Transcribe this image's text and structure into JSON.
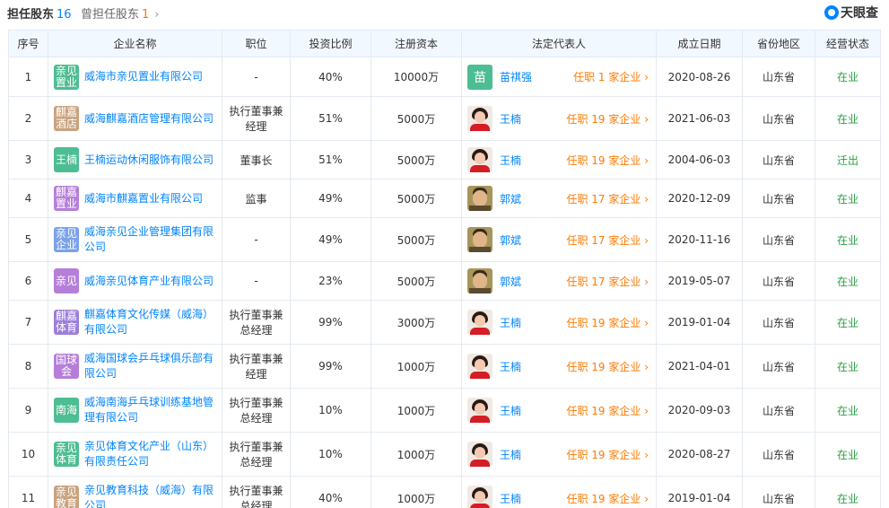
{
  "header": {
    "active_tab": "担任股东",
    "active_count": "16",
    "other_tab": "曾担任股东",
    "other_count": "1",
    "chevron": "›",
    "logo_text": "天眼查"
  },
  "columns": [
    "序号",
    "企业名称",
    "职位",
    "投资比例",
    "注册资本",
    "法定代表人",
    "成立日期",
    "省份地区",
    "经营状态"
  ],
  "rows": [
    {
      "idx": "1",
      "logo_text": "亲见置业",
      "logo_color": "#4dbd93",
      "name": "威海市亲见置业有限公司",
      "position": "-",
      "ratio": "40%",
      "capital": "10000万",
      "rep_name": "苗祺强",
      "rep_avatar": "苗",
      "rep_avatar_color": "#4dbd93",
      "rep_link": "任职 1 家企业",
      "date": "2020-08-26",
      "region": "山东省",
      "status": "在业",
      "status_color": "#27a243"
    },
    {
      "idx": "2",
      "logo_text": "麒嘉酒店",
      "logo_color": "#c9a27e",
      "name": "威海麒嘉酒店管理有限公司",
      "position": "执行董事兼经理",
      "ratio": "51%",
      "capital": "5000万",
      "rep_name": "王楠",
      "rep_avatar": "",
      "rep_avatar_color": "",
      "rep_link": "任职 19 家企业",
      "date": "2021-06-03",
      "region": "山东省",
      "status": "在业",
      "status_color": "#27a243"
    },
    {
      "idx": "3",
      "logo_text": "王楠",
      "logo_color": "#4dbd93",
      "name": "王楠运动休闲服饰有限公司",
      "position": "董事长",
      "ratio": "51%",
      "capital": "5000万",
      "rep_name": "王楠",
      "rep_avatar": "",
      "rep_avatar_color": "",
      "rep_link": "任职 19 家企业",
      "date": "2004-06-03",
      "region": "山东省",
      "status": "迁出",
      "status_color": "#27a243"
    },
    {
      "idx": "4",
      "logo_text": "麒嘉置业",
      "logo_color": "#b67ed8",
      "name": "威海市麒嘉置业有限公司",
      "position": "监事",
      "ratio": "49%",
      "capital": "5000万",
      "rep_name": "郭斌",
      "rep_avatar": "",
      "rep_avatar_color": "",
      "rep_link": "任职 17 家企业",
      "date": "2020-12-09",
      "region": "山东省",
      "status": "在业",
      "status_color": "#27a243"
    },
    {
      "idx": "5",
      "logo_text": "亲见企业",
      "logo_color": "#7aa2e8",
      "name": "威海亲见企业管理集团有限公司",
      "position": "-",
      "ratio": "49%",
      "capital": "5000万",
      "rep_name": "郭斌",
      "rep_avatar": "",
      "rep_avatar_color": "",
      "rep_link": "任职 17 家企业",
      "date": "2020-11-16",
      "region": "山东省",
      "status": "在业",
      "status_color": "#27a243"
    },
    {
      "idx": "6",
      "logo_text": "亲见",
      "logo_color": "#b67ed8",
      "name": "威海亲见体育产业有限公司",
      "position": "-",
      "ratio": "23%",
      "capital": "5000万",
      "rep_name": "郭斌",
      "rep_avatar": "",
      "rep_avatar_color": "",
      "rep_link": "任职 17 家企业",
      "date": "2019-05-07",
      "region": "山东省",
      "status": "在业",
      "status_color": "#27a243"
    },
    {
      "idx": "7",
      "logo_text": "麒嘉体育",
      "logo_color": "#9b7ed8",
      "name": "麒嘉体育文化传媒（威海）有限公司",
      "position": "执行董事兼总经理",
      "ratio": "99%",
      "capital": "3000万",
      "rep_name": "王楠",
      "rep_avatar": "",
      "rep_avatar_color": "",
      "rep_link": "任职 19 家企业",
      "date": "2019-01-04",
      "region": "山东省",
      "status": "在业",
      "status_color": "#27a243"
    },
    {
      "idx": "8",
      "logo_text": "国球会",
      "logo_color": "#b67ed8",
      "name": "威海国球会乒乓球俱乐部有限公司",
      "position": "执行董事兼经理",
      "ratio": "99%",
      "capital": "1000万",
      "rep_name": "王楠",
      "rep_avatar": "",
      "rep_avatar_color": "",
      "rep_link": "任职 19 家企业",
      "date": "2021-04-01",
      "region": "山东省",
      "status": "在业",
      "status_color": "#27a243"
    },
    {
      "idx": "9",
      "logo_text": "南海",
      "logo_color": "#4dbd93",
      "name": "威海南海乒乓球训练基地管理有限公司",
      "position": "执行董事兼总经理",
      "ratio": "10%",
      "capital": "1000万",
      "rep_name": "王楠",
      "rep_avatar": "",
      "rep_avatar_color": "",
      "rep_link": "任职 19 家企业",
      "date": "2020-09-03",
      "region": "山东省",
      "status": "在业",
      "status_color": "#27a243"
    },
    {
      "idx": "10",
      "logo_text": "亲见体育",
      "logo_color": "#4dbd93",
      "name": "亲见体育文化产业（山东）有限责任公司",
      "position": "执行董事兼总经理",
      "ratio": "10%",
      "capital": "1000万",
      "rep_name": "王楠",
      "rep_avatar": "",
      "rep_avatar_color": "",
      "rep_link": "任职 19 家企业",
      "date": "2020-08-27",
      "region": "山东省",
      "status": "在业",
      "status_color": "#27a243"
    },
    {
      "idx": "11",
      "logo_text": "亲见教育",
      "logo_color": "#c9a27e",
      "name": "亲见教育科技（威海）有限公司",
      "position": "执行董事兼总经理",
      "ratio": "40%",
      "capital": "1000万",
      "rep_name": "王楠",
      "rep_avatar": "",
      "rep_avatar_color": "",
      "rep_link": "任职 19 家企业",
      "date": "2019-01-04",
      "region": "山东省",
      "status": "在业",
      "status_color": "#27a243"
    }
  ]
}
